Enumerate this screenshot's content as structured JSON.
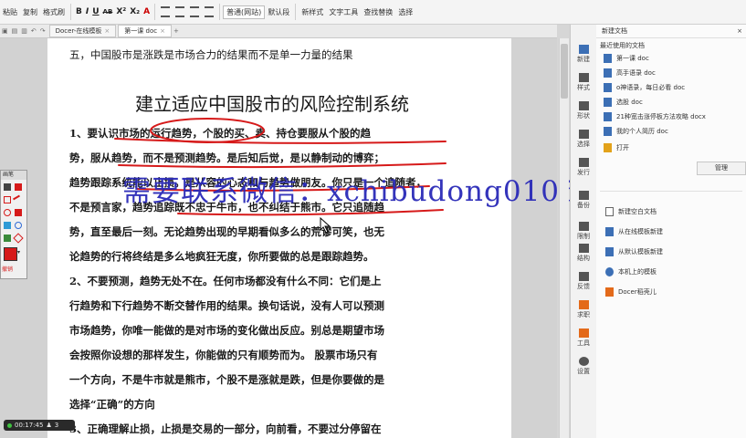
{
  "ribbon": {
    "paste": "粘贴",
    "copy": "复制",
    "format_painter": "格式刷",
    "bold": "B",
    "italic": "I",
    "underline": "U",
    "strikethrough": "AB",
    "superscript": "X²",
    "subscript": "X₂",
    "font_color": "A",
    "style_box": "普通(网站)",
    "style_default": "默认段",
    "new_style": "新样式",
    "text_tools": "文字工具",
    "find_replace": "查找替换",
    "select": "选择"
  },
  "tabs": {
    "tab1": "Docer-在线模板",
    "tab2": "第一课 doc",
    "add": "+"
  },
  "document": {
    "line_top": "五，中国股市是涨跌是市场合力的结果而不是单一力量的结果",
    "heading": "建立适应中国股市的风险控制系统",
    "lines": [
      "1、要认识市场的运行趋势，个股的买、卖、持仓要服从个股的趋",
      "势，服从趋势，而不是预测趋势。是后知后觉，是以静制动的博弈；",
      "趋势跟踪系统能以止损。是从容的心态和与趋势做朋友。你只是一个追随者，",
      "不是预言家，趋势追踪既不忠于牛市，也不纠结于熊市。它只追随趋",
      "势，直至最后一刻。无论趋势出现的早期看似多么的荒谬可笑，也无",
      "论趋势的行将终结是多么地疯狂无度，你所要做的总是跟踪趋势。",
      "2、不要预测，趋势无处不在。任何市场都没有什么不同：它们是上",
      "行趋势和下行趋势不断交替作用的结果。换句话说，没有人可以预测",
      "市场趋势，你唯一能做的是对市场的变化做出反应。别总是期望市场",
      "会按照你设想的那样发生，你能做的只有顺势而为。   股票市场只有",
      "一个方向，不是牛市就是熊市，个股不是涨就是跌，但是你要做的是",
      "选择“正确”的方向",
      "3、正确理解止损，止损是交易的一部分，向前看，不要过分停留在"
    ]
  },
  "watermark": "需要联系微信：xchibudong0105",
  "side_strip": {
    "items": [
      "新建",
      "样式",
      "形状",
      "选择",
      "发行",
      "备份",
      "限制",
      "结构",
      "反馈",
      "求职",
      "工具",
      "设置"
    ]
  },
  "panel": {
    "title": "新建文档",
    "recent_title": "最近使用的文档",
    "recent": [
      "第一课 doc",
      "高手语录 doc",
      "o神语录，每日必看 doc",
      "选股 doc",
      "21种宽击涨停板方法攻略 docx",
      "我的个人简历 doc"
    ],
    "open": "打开",
    "manage": "管理",
    "new_items": [
      "新建空白文档",
      "从在线模板新建",
      "从默认模板新建",
      "本机上的模板",
      "Docer稻壳儿"
    ]
  },
  "annot_toolbar": {
    "title": "画笔",
    "undo": "撤销"
  },
  "recorder": {
    "time": "00:17:45",
    "count": "3"
  },
  "colors": {
    "watermark": "#2a2ab8",
    "annotation_red": "#d61a1a",
    "panel_icon_blue": "#3c6fb5",
    "panel_icon_orange": "#e36a1a"
  }
}
